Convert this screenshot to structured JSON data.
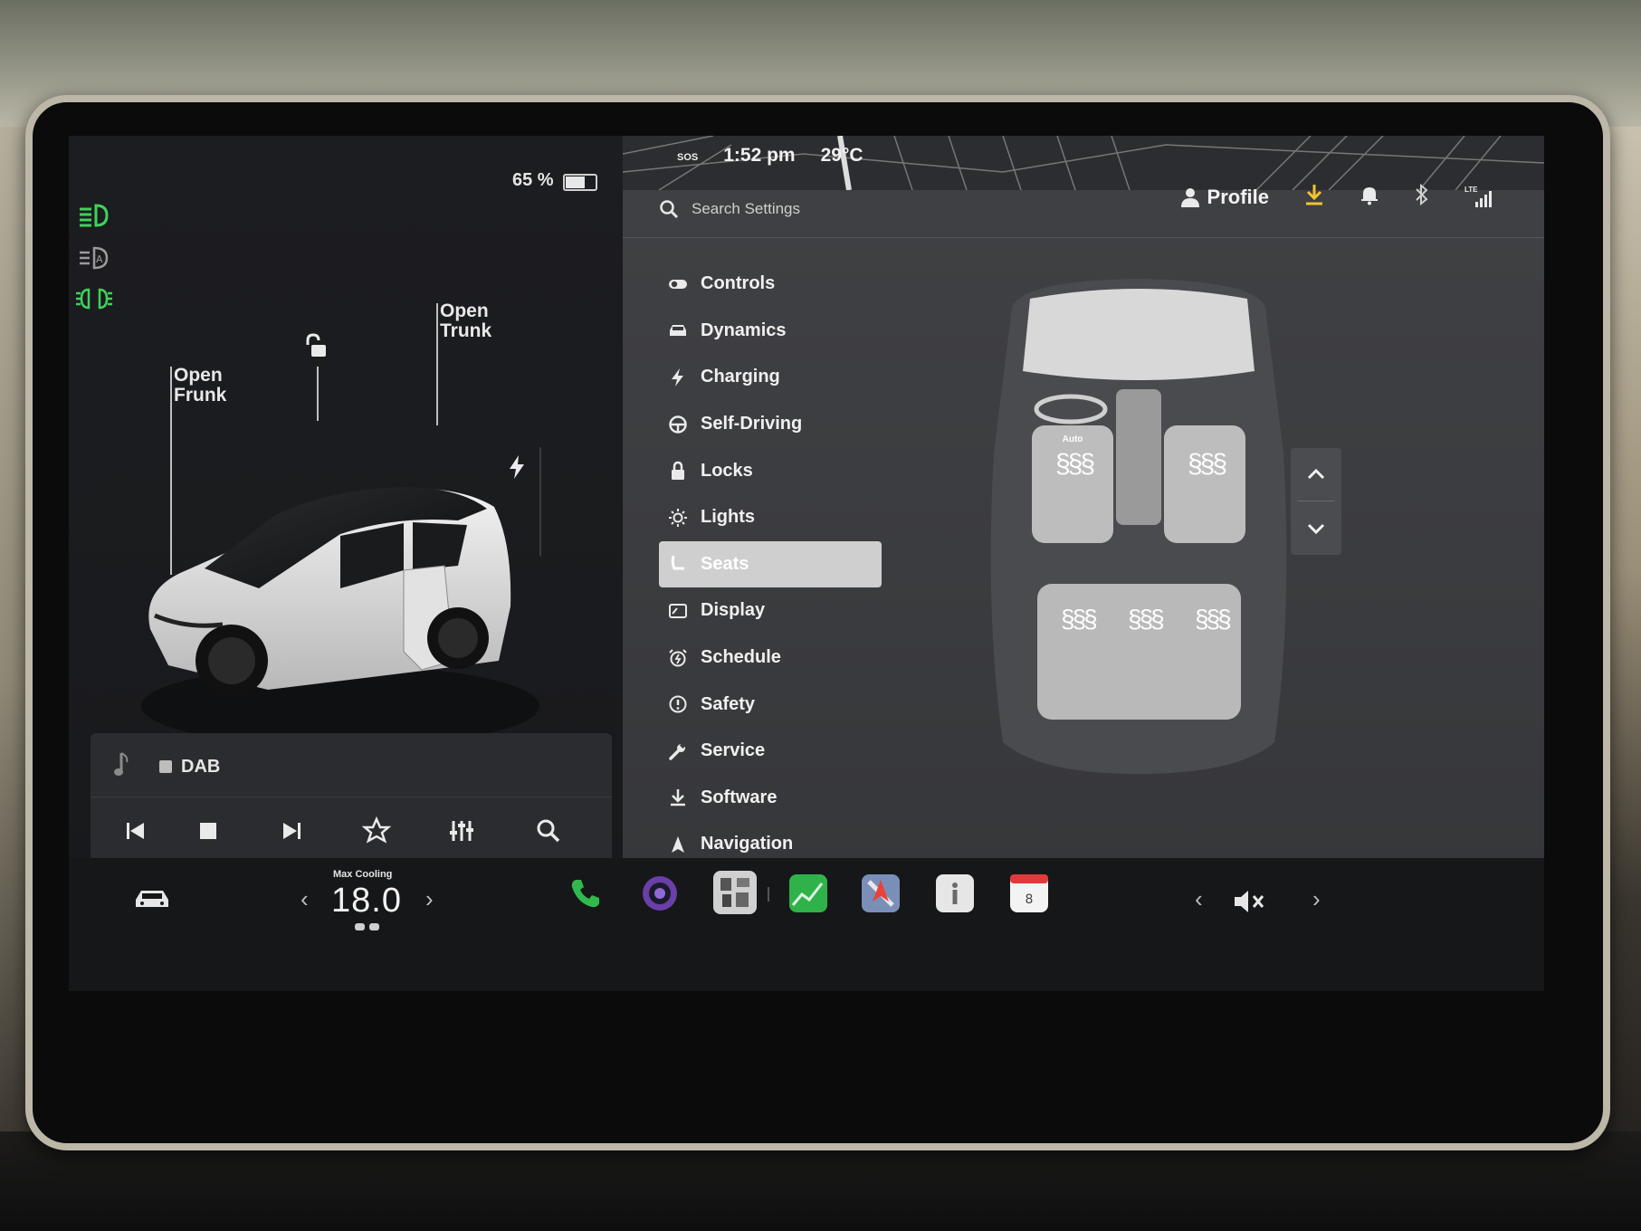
{
  "status": {
    "battery": "65 %",
    "time": "1:52 pm",
    "temperature": "29°C",
    "sos": "SOS",
    "network": "LTE"
  },
  "car": {
    "open_frunk": "Open\nFrunk",
    "open_trunk": "Open\nTrunk"
  },
  "media": {
    "source": "DAB",
    "controls": [
      "previous",
      "stop",
      "next",
      "favorite",
      "equalizer",
      "search"
    ]
  },
  "settings": {
    "search_placeholder": "Search Settings",
    "profile_label": "Profile",
    "menu": [
      {
        "label": "Controls",
        "icon": "toggle-icon"
      },
      {
        "label": "Dynamics",
        "icon": "car-icon"
      },
      {
        "label": "Charging",
        "icon": "bolt-icon"
      },
      {
        "label": "Self-Driving",
        "icon": "steering-wheel-icon"
      },
      {
        "label": "Locks",
        "icon": "lock-icon"
      },
      {
        "label": "Lights",
        "icon": "sun-icon"
      },
      {
        "label": "Seats",
        "icon": "seat-icon",
        "selected": true
      },
      {
        "label": "Display",
        "icon": "display-icon"
      },
      {
        "label": "Schedule",
        "icon": "alarm-icon"
      },
      {
        "label": "Safety",
        "icon": "alert-icon"
      },
      {
        "label": "Service",
        "icon": "wrench-icon"
      },
      {
        "label": "Software",
        "icon": "download-icon"
      },
      {
        "label": "Navigation",
        "icon": "navigation-icon"
      }
    ],
    "driver_seat_mode": "Auto"
  },
  "climate": {
    "mode_label": "Max Cooling",
    "temperature": "18.0"
  },
  "colors": {
    "headlight_green": "#3fd35a",
    "download_yellow": "#f2c230",
    "phone_green": "#31b94d"
  }
}
